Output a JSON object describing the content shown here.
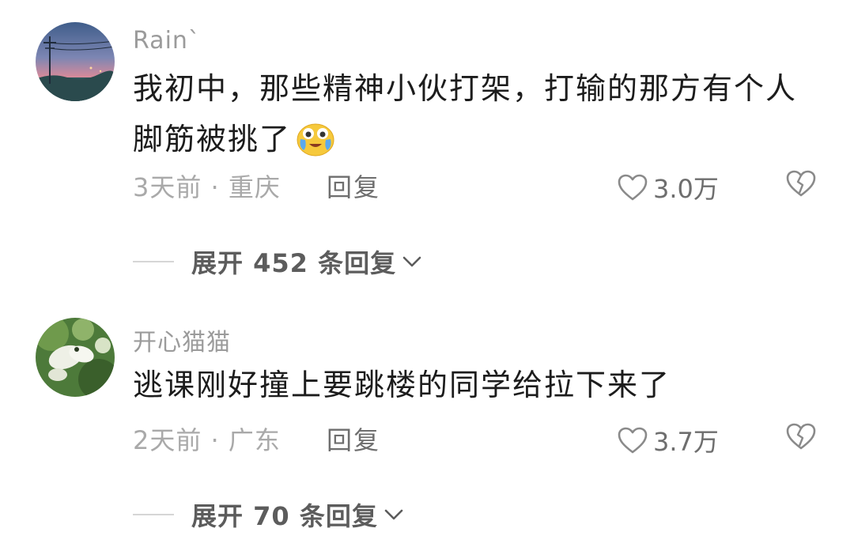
{
  "comments": [
    {
      "username": "Rain`",
      "content": "我初中，那些精神小伙打架，打输的那方有个人脚筋被挑了",
      "emoji": "crying-laughing-emoji",
      "time_location": "3天前 · 重庆",
      "reply_label": "回复",
      "likes": "3.0万",
      "expand_label": "展开 452 条回复"
    },
    {
      "username": "开心猫猫",
      "content": "逃课刚好撞上要跳楼的同学给拉下来了",
      "time_location": "2天前 · 广东",
      "reply_label": "回复",
      "likes": "3.7万",
      "expand_label": "展开 70 条回复"
    }
  ],
  "icons": {
    "like": "heart-outline-icon",
    "dislike": "broken-heart-icon",
    "expand": "chevron-down-icon"
  },
  "colors": {
    "username": "#9b9b9b",
    "content": "#1c1c1c",
    "meta": "#a9a9a9",
    "action": "#6e6e6e"
  }
}
